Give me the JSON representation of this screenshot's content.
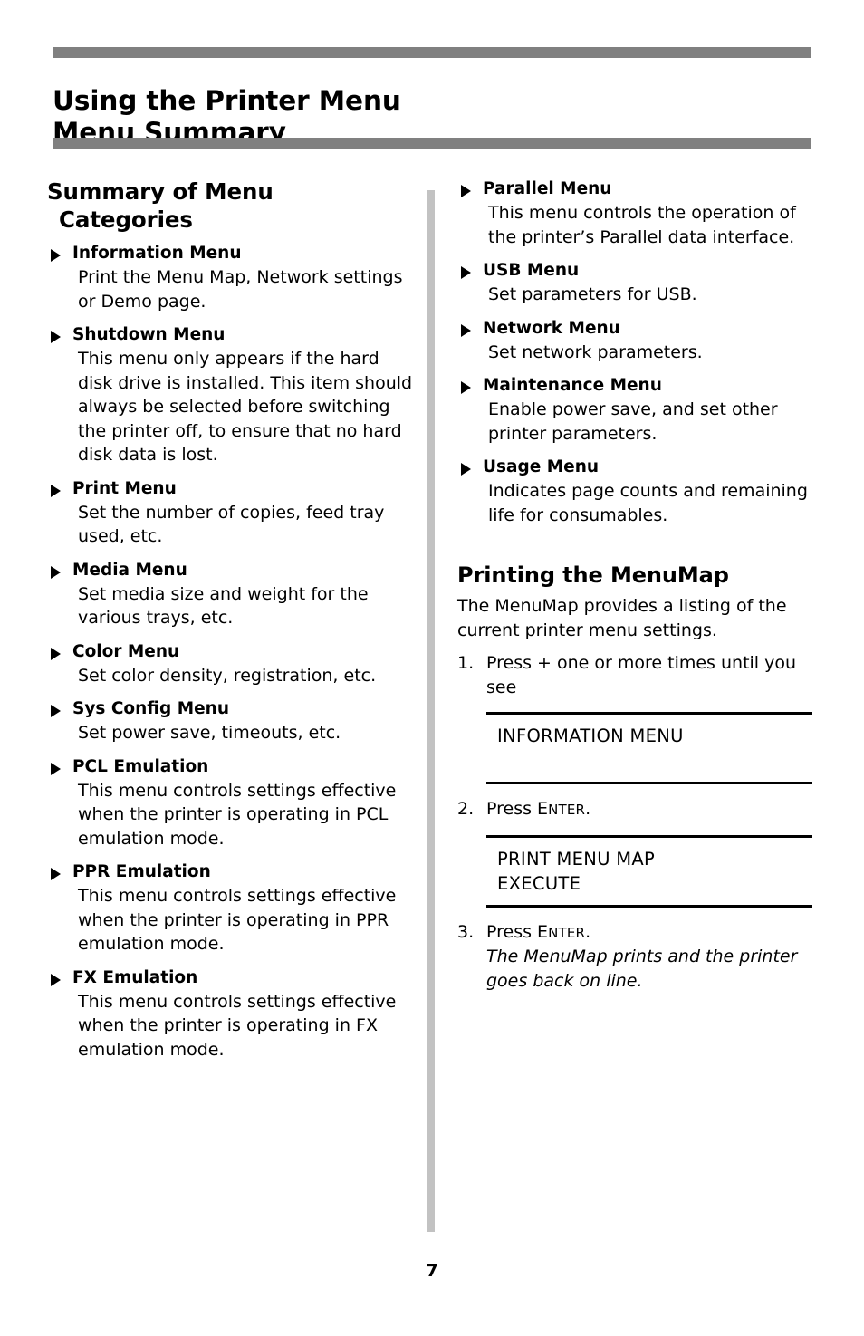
{
  "header": {
    "title_line1": "Using the Printer Menu",
    "title_line2": "Menu Summary",
    "bar_color": "#808080"
  },
  "divider": {
    "color": "#c2c2c2"
  },
  "left_column": {
    "heading_line1": "Summary of Menu",
    "heading_line2": "Categories",
    "items": [
      {
        "title": "Information Menu",
        "body": "Print the Menu Map, Network settings or Demo page."
      },
      {
        "title": "Shutdown Menu",
        "body": "This menu only appears if the hard disk drive is installed. This item should always be selected before switching the printer off, to ensure that no hard disk data is lost."
      },
      {
        "title": "Print Menu",
        "body": "Set the number of copies, feed tray used, etc."
      },
      {
        "title": "Media Menu",
        "body": "Set media size and weight for the various trays, etc."
      },
      {
        "title": "Color Menu",
        "body": "Set color density, registration, etc."
      },
      {
        "title": "Sys Config Menu",
        "body": "Set power save, timeouts, etc."
      },
      {
        "title": "PCL Emulation",
        "body": "This menu controls settings effective when the printer is operating in PCL emulation mode."
      },
      {
        "title": "PPR Emulation",
        "body": "This menu controls settings effective when the printer is operating in PPR emulation mode."
      },
      {
        "title": "FX Emulation",
        "body": "This menu controls settings effective when the printer is operating in FX emulation mode."
      }
    ]
  },
  "right_column": {
    "items": [
      {
        "title": "Parallel Menu",
        "body": "This menu controls the operation of the printer’s Parallel data interface."
      },
      {
        "title": "USB Menu",
        "body": "Set parameters for USB."
      },
      {
        "title": "Network Menu",
        "body": "Set network parameters."
      },
      {
        "title": "Maintenance Menu",
        "body": "Enable power save, and set other printer parameters."
      },
      {
        "title": "Usage Menu",
        "body": "Indicates page counts and remaining life for consumables."
      }
    ],
    "menumap": {
      "heading": "Printing the MenuMap",
      "intro": "The MenuMap provides a listing of the current printer menu settings.",
      "step1_num": "1.",
      "step1_text": "Press + one or more times until you see",
      "display1_line1": "INFORMATION MENU",
      "display1_line2": "",
      "step2_num": "2.",
      "step2_prefix": "Press ",
      "step2_key_first": "E",
      "step2_key_rest": "NTER",
      "step2_suffix": ".",
      "display2_line1": "PRINT MENU MAP",
      "display2_line2": "EXECUTE",
      "step3_num": "3.",
      "step3_prefix": "Press ",
      "step3_key_first": "E",
      "step3_key_rest": "NTER",
      "step3_suffix": ".",
      "step3_note": "The MenuMap prints and the printer goes back on line."
    }
  },
  "footer": {
    "page_number": "7"
  }
}
